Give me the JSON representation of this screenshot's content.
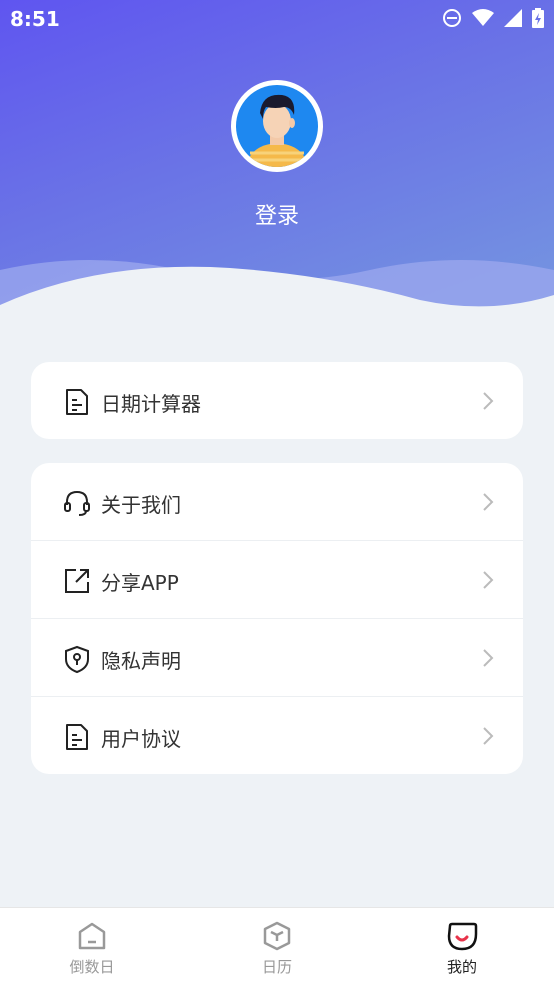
{
  "status_bar": {
    "time": "8:51"
  },
  "profile": {
    "login_label": "登录"
  },
  "menu_primary": [
    {
      "label": "日期计算器",
      "icon": "document-icon"
    }
  ],
  "menu_secondary": [
    {
      "label": "关于我们",
      "icon": "headset-icon"
    },
    {
      "label": "分享APP",
      "icon": "share-icon"
    },
    {
      "label": "隐私声明",
      "icon": "shield-icon"
    },
    {
      "label": "用户协议",
      "icon": "document-icon"
    }
  ],
  "tabbar": [
    {
      "label": "倒数日",
      "active": false
    },
    {
      "label": "日历",
      "active": false
    },
    {
      "label": "我的",
      "active": true
    }
  ],
  "colors": {
    "header_start": "#5f55f0",
    "header_end": "#7596e0",
    "avatar_bg": "#1e88f0",
    "background": "#eef2f6"
  }
}
